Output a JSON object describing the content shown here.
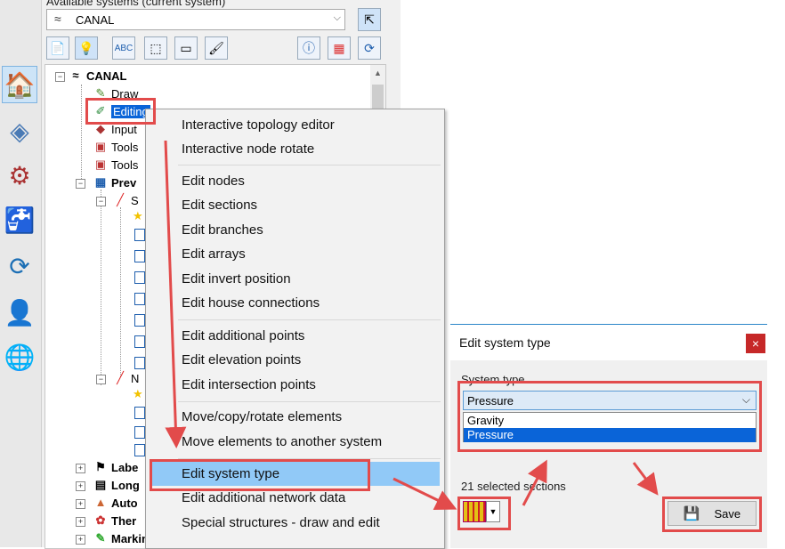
{
  "left_panel": {
    "available_label": "Available systems (current system)",
    "system_combo_value": "CANAL"
  },
  "toolbar_icons": [
    "document-icon",
    "lightbulb-icon",
    "abc-label-icon",
    "select-cursor-icon",
    "window-icon",
    "brush-icon",
    "info-icon",
    "grid-icon",
    "refresh-icon"
  ],
  "vertical_icons": [
    "house-icon",
    "grid-diamond-icon",
    "pipe-valve-icon",
    "faucet-icon",
    "network-icon",
    "user-info-icon",
    "globe-icon"
  ],
  "tree": {
    "root": "CANAL",
    "items": [
      "Draw",
      "Editing",
      "Input",
      "Tools",
      "Tools",
      "Prev",
      "S",
      "N",
      "Labe",
      "Long",
      "Auto",
      "Ther",
      "Marking"
    ]
  },
  "context_menu": {
    "group1": [
      "Interactive topology editor",
      "Interactive node rotate"
    ],
    "group2": [
      "Edit nodes",
      "Edit sections",
      "Edit branches",
      "Edit arrays",
      "Edit invert position",
      "Edit house connections"
    ],
    "group3": [
      "Edit additional points",
      "Edit elevation points",
      "Edit intersection points"
    ],
    "group4": [
      "Move/copy/rotate elements",
      "Move elements to another system"
    ],
    "group5": [
      "Edit system type",
      "Edit additional network data",
      "Special structures - draw and edit"
    ]
  },
  "dialog": {
    "title": "Edit system type",
    "close": "×",
    "system_type_label": "System type",
    "selected_value": "Pressure",
    "options": [
      "Gravity",
      "Pressure"
    ],
    "selected_count": "21 selected sections",
    "save_label": "Save"
  }
}
